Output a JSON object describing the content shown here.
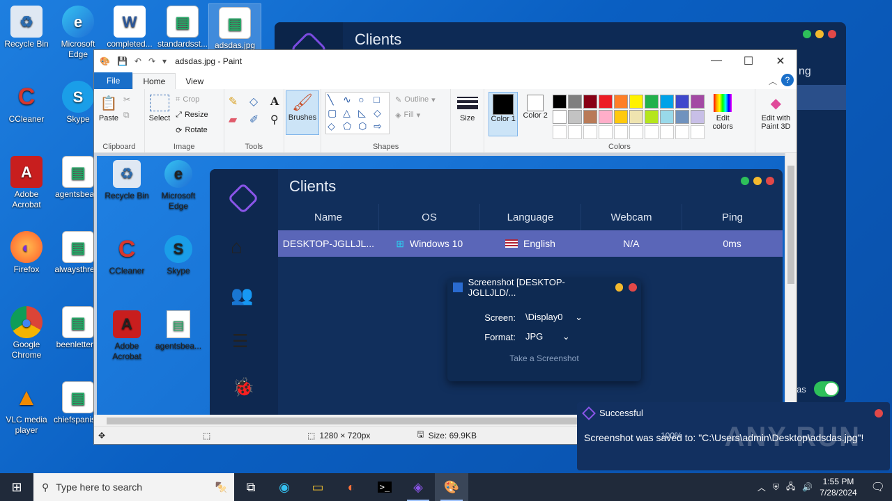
{
  "desktop": {
    "icons": [
      {
        "label": "Recycle Bin",
        "glyph": "♻",
        "color": "#6aa9e8"
      },
      {
        "label": "Microsoft Edge",
        "glyph": "e",
        "color": "#1f9ad6"
      },
      {
        "label": "completed...",
        "glyph": "W",
        "color": "#2b579a"
      },
      {
        "label": "standardsst...",
        "glyph": "▤",
        "color": "#ffffff"
      },
      {
        "label": "adsdas.jpg",
        "glyph": "▤",
        "color": "#ffffff"
      },
      {
        "label": "CCleaner",
        "glyph": "C",
        "color": "#d7372e"
      },
      {
        "label": "Skype",
        "glyph": "S",
        "color": "#1a9ee8"
      },
      {
        "label": "Adobe Acrobat",
        "glyph": "A",
        "color": "#c81e1e"
      },
      {
        "label": "agentsbea...",
        "glyph": "▤",
        "color": "#ffffff"
      },
      {
        "label": "Firefox",
        "glyph": "🦊",
        "color": "#ff7139"
      },
      {
        "label": "alwaysthre...",
        "glyph": "▤",
        "color": "#ffffff"
      },
      {
        "label": "Google Chrome",
        "glyph": "◉",
        "color": "#4caf50"
      },
      {
        "label": "beenletter...",
        "glyph": "▤",
        "color": "#ffffff"
      },
      {
        "label": "VLC media player",
        "glyph": "▲",
        "color": "#f08a00"
      },
      {
        "label": "chiefspanis...",
        "glyph": "▤",
        "color": "#ffffff"
      }
    ]
  },
  "bg_clients": {
    "title": "Clients",
    "partial_text": "ng",
    "partial_toggle_label": "as"
  },
  "paint": {
    "title": "adsdas.jpg - Paint",
    "tabs": {
      "file": "File",
      "home": "Home",
      "view": "View"
    },
    "clipboard": {
      "paste": "Paste",
      "label": "Clipboard"
    },
    "image": {
      "select": "Select",
      "crop": "Crop",
      "resize": "Resize",
      "rotate": "Rotate",
      "label": "Image"
    },
    "tools": {
      "label": "Tools"
    },
    "brushes": "Brushes",
    "shapes": {
      "outline": "Outline",
      "fill": "Fill",
      "label": "Shapes"
    },
    "size": "Size",
    "color1": "Color 1",
    "color2": "Color 2",
    "colors_label": "Colors",
    "edit_colors": "Edit colors",
    "edit_paint3d": "Edit with Paint 3D",
    "palette": [
      "#000000",
      "#7f7f7f",
      "#880015",
      "#ed1c24",
      "#ff7f27",
      "#fff200",
      "#22b14c",
      "#00a2e8",
      "#3f48cc",
      "#a349a4",
      "#ffffff",
      "#c3c3c3",
      "#b97a57",
      "#ffaec9",
      "#ffc90e",
      "#efe4b0",
      "#b5e61d",
      "#99d9ea",
      "#7092be",
      "#c8bfe7"
    ],
    "status": {
      "dimensions": "1280 × 720px",
      "size": "Size: 69.9KB",
      "zoom": "100%"
    }
  },
  "inner": {
    "desktop_icons": [
      {
        "label": "Recycle Bin"
      },
      {
        "label": "Microsoft Edge"
      },
      {
        "label": "CCleaner"
      },
      {
        "label": "Skype"
      },
      {
        "label": "Adobe Acrobat"
      },
      {
        "label": "agentsbea..."
      }
    ],
    "clients": {
      "title": "Clients",
      "columns": [
        "Name",
        "OS",
        "Language",
        "Webcam",
        "Ping"
      ],
      "row": {
        "name": "DESKTOP-JGLLJL...",
        "os": "Windows 10",
        "language": "English",
        "webcam": "N/A",
        "ping": "0ms"
      }
    },
    "screenshot_dialog": {
      "title": "Screenshot [DESKTOP-JGLLJLD/...",
      "screen_label": "Screen:",
      "screen_value": "\\Display0",
      "format_label": "Format:",
      "format_value": "JPG",
      "action": "Take a Screenshot"
    }
  },
  "toast": {
    "title": "Successful",
    "message": "Screenshot was saved to: \"C:\\Users\\admin\\Desktop\\adsdas.jpg\"!",
    "watermark": "ANY RUN"
  },
  "taskbar": {
    "search_placeholder": "Type here to search",
    "time": "1:55 PM",
    "date": "7/28/2024"
  }
}
